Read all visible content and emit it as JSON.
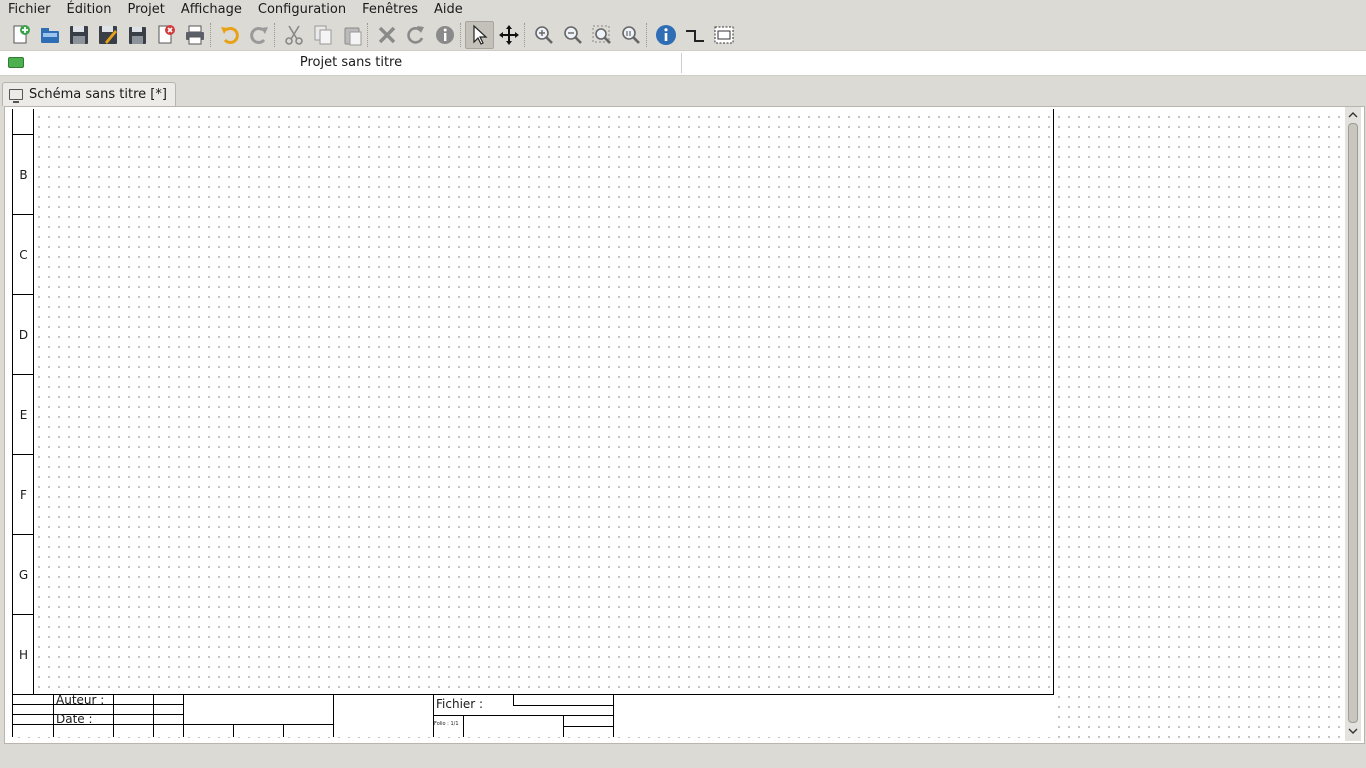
{
  "menubar": {
    "items": [
      "Fichier",
      "Édition",
      "Projet",
      "Affichage",
      "Configuration",
      "Fenêtres",
      "Aide"
    ]
  },
  "toolbar": {
    "buttons": [
      {
        "name": "new-project-icon",
        "active": false
      },
      {
        "name": "open-icon",
        "active": false
      },
      {
        "name": "save-icon",
        "active": false
      },
      {
        "name": "save-as-icon",
        "active": false
      },
      {
        "name": "save-all-icon",
        "active": false
      },
      {
        "name": "close-project-icon",
        "active": false
      },
      {
        "name": "print-icon",
        "active": false
      },
      {
        "name": "undo-icon",
        "active": false
      },
      {
        "name": "redo-icon",
        "active": false
      },
      {
        "name": "cut-icon",
        "active": false
      },
      {
        "name": "copy-icon",
        "active": false
      },
      {
        "name": "paste-icon",
        "active": false
      },
      {
        "name": "delete-icon",
        "active": false
      },
      {
        "name": "rotate-icon",
        "active": false
      },
      {
        "name": "properties-icon",
        "active": false
      },
      {
        "name": "select-pointer-icon",
        "active": true
      },
      {
        "name": "move-icon",
        "active": false
      },
      {
        "name": "zoom-in-icon",
        "active": false
      },
      {
        "name": "zoom-out-icon",
        "active": false
      },
      {
        "name": "zoom-fit-icon",
        "active": false
      },
      {
        "name": "zoom-reset-icon",
        "active": false
      },
      {
        "name": "info-icon",
        "active": false
      },
      {
        "name": "conductor-icon",
        "active": false
      },
      {
        "name": "text-field-icon",
        "active": false
      }
    ],
    "accent_blue": "#2f6db5",
    "accent_orange": "#e8a217"
  },
  "project": {
    "title": "Projet sans titre",
    "icon_color": "#4caf50"
  },
  "tabs": [
    {
      "label": "Schéma sans titre [*]",
      "icon": "schema-icon"
    }
  ],
  "sheet": {
    "rows": [
      "B",
      "C",
      "D",
      "E",
      "F",
      "G",
      "H"
    ],
    "titleblock": {
      "author_label": "Auteur :",
      "date_label": "Date :",
      "file_label": "Fichier :",
      "folio_label": "Folio : 1/1"
    }
  }
}
